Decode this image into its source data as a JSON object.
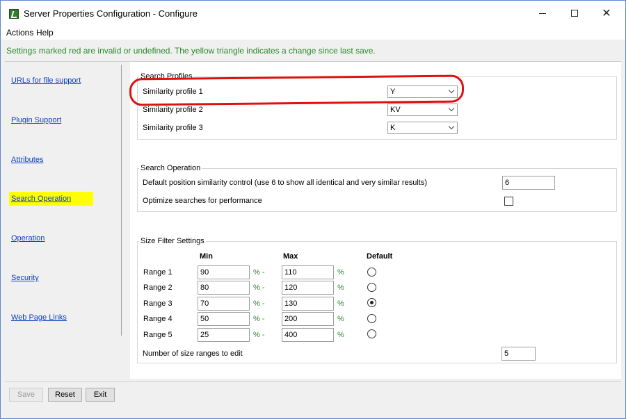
{
  "window": {
    "title": "Server Properties Configuration - Configure"
  },
  "menu": {
    "items": [
      "Actions",
      "Help"
    ]
  },
  "banner": "Settings marked red are invalid or undefined.  The yellow triangle indicates a change since last save.",
  "sidebar": {
    "items": [
      {
        "label": "URLs for file support"
      },
      {
        "label": "Plugin Support"
      },
      {
        "label": "Attributes"
      },
      {
        "label": "Search Operation"
      },
      {
        "label": "Operation"
      },
      {
        "label": "Security"
      },
      {
        "label": "Web Page Links"
      }
    ],
    "active_index": 3,
    "highlight_color": "#ffff00"
  },
  "search_profiles": {
    "title": "Search Profiles",
    "rows": [
      {
        "label": "Similarity profile 1",
        "value": "Y"
      },
      {
        "label": "Similarity profile 2",
        "value": "KV"
      },
      {
        "label": "Similarity profile 3",
        "value": "K"
      }
    ]
  },
  "search_operation": {
    "title": "Search Operation",
    "position_label": "Default position similarity control (use 6 to show all identical and very similar results)",
    "position_value": "6",
    "optimize_label": "Optimize searches for performance",
    "optimize_checked": false
  },
  "size_filter": {
    "title": "Size Filter Settings",
    "col_min": "Min",
    "col_max": "Max",
    "col_default": "Default",
    "pct_dash": "% -",
    "pct": "%",
    "ranges": [
      {
        "label": "Range 1",
        "min": "90",
        "max": "110",
        "default": false
      },
      {
        "label": "Range 2",
        "min": "80",
        "max": "120",
        "default": false
      },
      {
        "label": "Range 3",
        "min": "70",
        "max": "130",
        "default": true
      },
      {
        "label": "Range 4",
        "min": "50",
        "max": "200",
        "default": false
      },
      {
        "label": "Range 5",
        "min": "25",
        "max": "400",
        "default": false
      }
    ],
    "count_label": "Number of size ranges to edit",
    "count_value": "5"
  },
  "footer": {
    "save": "Save",
    "reset": "Reset",
    "exit": "Exit"
  },
  "colors": {
    "accent_green": "#2a8a2a",
    "link_blue": "#0b3fbf",
    "annotation_red": "#e01010"
  }
}
